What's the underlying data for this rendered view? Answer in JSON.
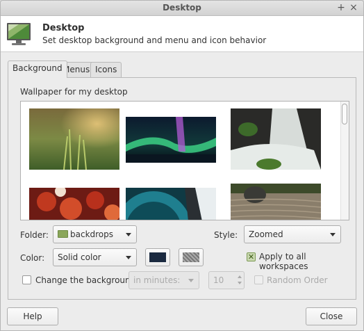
{
  "window": {
    "title": "Desktop"
  },
  "titlebar_buttons": {
    "plus": "+",
    "close": "×"
  },
  "header": {
    "title": "Desktop",
    "subtitle": "Set desktop background and menu and icon behavior",
    "icon": "monitor-icon"
  },
  "tabs": [
    {
      "label": "Background",
      "active": true
    },
    {
      "label": "Menus",
      "active": false
    },
    {
      "label": "Icons",
      "active": false
    }
  ],
  "wallpaper": {
    "label": "Wallpaper for my desktop",
    "thumbnails": [
      "bokeh-grass",
      "aurora",
      "waterfall",
      "red-maple-leaves",
      "teal-lens",
      "zen-garden"
    ]
  },
  "folder": {
    "label": "Folder:",
    "value": "backdrops"
  },
  "style": {
    "label": "Style:",
    "value": "Zoomed"
  },
  "color": {
    "label": "Color:",
    "value": "Solid color",
    "primary": "#1b2a40",
    "secondary": "#888888"
  },
  "apply_all": {
    "label": "Apply to all workspaces",
    "checked": true
  },
  "change_bg": {
    "label": "Change the background",
    "checked": false
  },
  "interval": {
    "value": "in minutes:"
  },
  "minutes": {
    "value": "10"
  },
  "random_order": {
    "label": "Random Order",
    "checked": false
  },
  "buttons": {
    "help": "Help",
    "close": "Close"
  }
}
